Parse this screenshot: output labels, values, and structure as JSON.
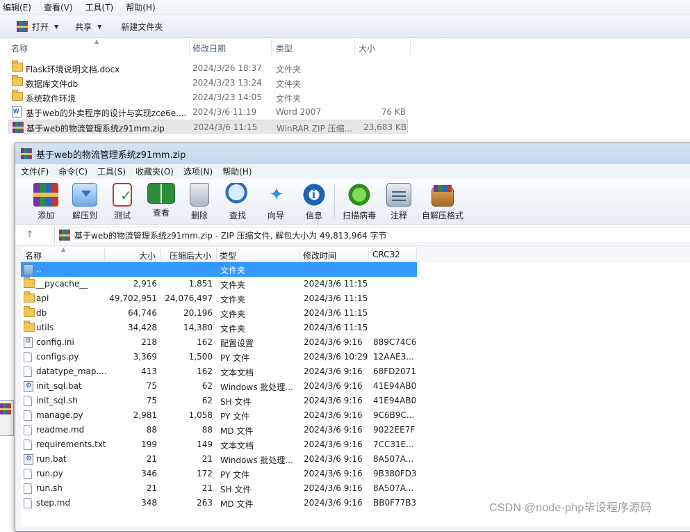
{
  "explorer": {
    "menu": [
      "编辑(E)",
      "查看(V)",
      "工具(T)",
      "帮助(H)"
    ],
    "toolbar": {
      "open": "打开",
      "share": "共享",
      "new_folder": "新建文件夹"
    },
    "columns": {
      "name": "名称",
      "date": "修改日期",
      "type": "类型",
      "size": "大小"
    },
    "rows": [
      {
        "name": "Flask环境说明文档.docx",
        "date": "2024/3/26 18:37",
        "type": "文件夹",
        "size": "",
        "icon": "folder-icon"
      },
      {
        "name": "数据库文件db",
        "date": "2024/3/23 13:24",
        "type": "文件夹",
        "size": "",
        "icon": "folder-icon"
      },
      {
        "name": "系统软件环境",
        "date": "2024/3/23 14:05",
        "type": "文件夹",
        "size": "",
        "icon": "folder-icon"
      },
      {
        "name": "基于web的外卖程序的设计与实现zce6e....",
        "date": "2024/3/6 11:19",
        "type": "Word 2007",
        "size": "76 KB",
        "icon": "word-icon"
      },
      {
        "name": "基于web的物流管理系统z91mm.zip",
        "date": "2024/3/6 11:15",
        "type": "WinRAR ZIP 压缩...",
        "size": "23,683 KB",
        "icon": "winrar-icon"
      }
    ]
  },
  "winrar": {
    "title": "基于web的物流管理系统z91mm.zip",
    "menu": [
      "文件(F)",
      "命令(C)",
      "工具(S)",
      "收藏夹(O)",
      "选项(N)",
      "帮助(H)"
    ],
    "toolbar": {
      "add": "添加",
      "extract": "解压到",
      "test": "测试",
      "view": "查看",
      "delete": "删除",
      "find": "查找",
      "wizard": "向导",
      "info": "信息",
      "scan": "扫描病毒",
      "comment": "注释",
      "sfx": "自解压格式"
    },
    "path": "基于web的物流管理系统z91mm.zip - ZIP 压缩文件, 解包大小为 49,813,964 字节",
    "up_arrow": "↑",
    "columns": {
      "name": "名称",
      "size": "大小",
      "packed": "压缩后大小",
      "type": "类型",
      "modified": "修改时间",
      "crc": "CRC32"
    },
    "rows": [
      {
        "name": "..",
        "size": "",
        "packed": "",
        "type": "文件夹",
        "modified": "",
        "crc": "",
        "icon": "up-folder-icon"
      },
      {
        "name": "__pycache__",
        "size": "2,916",
        "packed": "1,851",
        "type": "文件夹",
        "modified": "2024/3/6 11:15",
        "crc": "",
        "icon": "folder-icon"
      },
      {
        "name": "api",
        "size": "49,702,951",
        "packed": "24,076,497",
        "type": "文件夹",
        "modified": "2024/3/6 11:15",
        "crc": "",
        "icon": "folder-icon"
      },
      {
        "name": "db",
        "size": "64,746",
        "packed": "20,196",
        "type": "文件夹",
        "modified": "2024/3/6 11:15",
        "crc": "",
        "icon": "folder-icon"
      },
      {
        "name": "utils",
        "size": "34,428",
        "packed": "14,380",
        "type": "文件夹",
        "modified": "2024/3/6 11:15",
        "crc": "",
        "icon": "folder-icon"
      },
      {
        "name": "config.ini",
        "size": "218",
        "packed": "162",
        "type": "配置设置",
        "modified": "2024/3/6 9:16",
        "crc": "889C74C6",
        "icon": "config-file-icon"
      },
      {
        "name": "configs.py",
        "size": "3,369",
        "packed": "1,500",
        "type": "PY 文件",
        "modified": "2024/3/6 10:29",
        "crc": "12AAE3...",
        "icon": "file-icon"
      },
      {
        "name": "datatype_map....",
        "size": "413",
        "packed": "162",
        "type": "文本文档",
        "modified": "2024/3/6 9:16",
        "crc": "68FD2071",
        "icon": "file-icon"
      },
      {
        "name": "init_sql.bat",
        "size": "75",
        "packed": "62",
        "type": "Windows 批处理...",
        "modified": "2024/3/6 9:16",
        "crc": "41E94AB0",
        "icon": "batch-file-icon"
      },
      {
        "name": "init_sql.sh",
        "size": "75",
        "packed": "62",
        "type": "SH 文件",
        "modified": "2024/3/6 9:16",
        "crc": "41E94AB0",
        "icon": "file-icon"
      },
      {
        "name": "manage.py",
        "size": "2,981",
        "packed": "1,058",
        "type": "PY 文件",
        "modified": "2024/3/6 9:16",
        "crc": "9C6B9C...",
        "icon": "file-icon"
      },
      {
        "name": "readme.md",
        "size": "88",
        "packed": "88",
        "type": "MD 文件",
        "modified": "2024/3/6 9:16",
        "crc": "9022EE7F",
        "icon": "file-icon"
      },
      {
        "name": "requirements.txt",
        "size": "199",
        "packed": "149",
        "type": "文本文档",
        "modified": "2024/3/6 9:16",
        "crc": "7CC31E...",
        "icon": "file-icon"
      },
      {
        "name": "run.bat",
        "size": "21",
        "packed": "21",
        "type": "Windows 批处理...",
        "modified": "2024/3/6 9:16",
        "crc": "8A507A...",
        "icon": "batch-file-icon"
      },
      {
        "name": "run.py",
        "size": "346",
        "packed": "172",
        "type": "PY 文件",
        "modified": "2024/3/6 9:16",
        "crc": "9B380FD3",
        "icon": "file-icon"
      },
      {
        "name": "run.sh",
        "size": "21",
        "packed": "21",
        "type": "SH 文件",
        "modified": "2024/3/6 9:16",
        "crc": "8A507A...",
        "icon": "file-icon"
      },
      {
        "name": "step.md",
        "size": "348",
        "packed": "263",
        "type": "MD 文件",
        "modified": "2024/3/6 9:16",
        "crc": "BB0F77B3",
        "icon": "file-icon"
      }
    ]
  },
  "watermark": "CSDN @node-php毕设程序源码",
  "colors": {
    "selection": "#3399ff",
    "title_bar": "#c2d6ee",
    "explorer_selected": "#e6e6e6"
  }
}
